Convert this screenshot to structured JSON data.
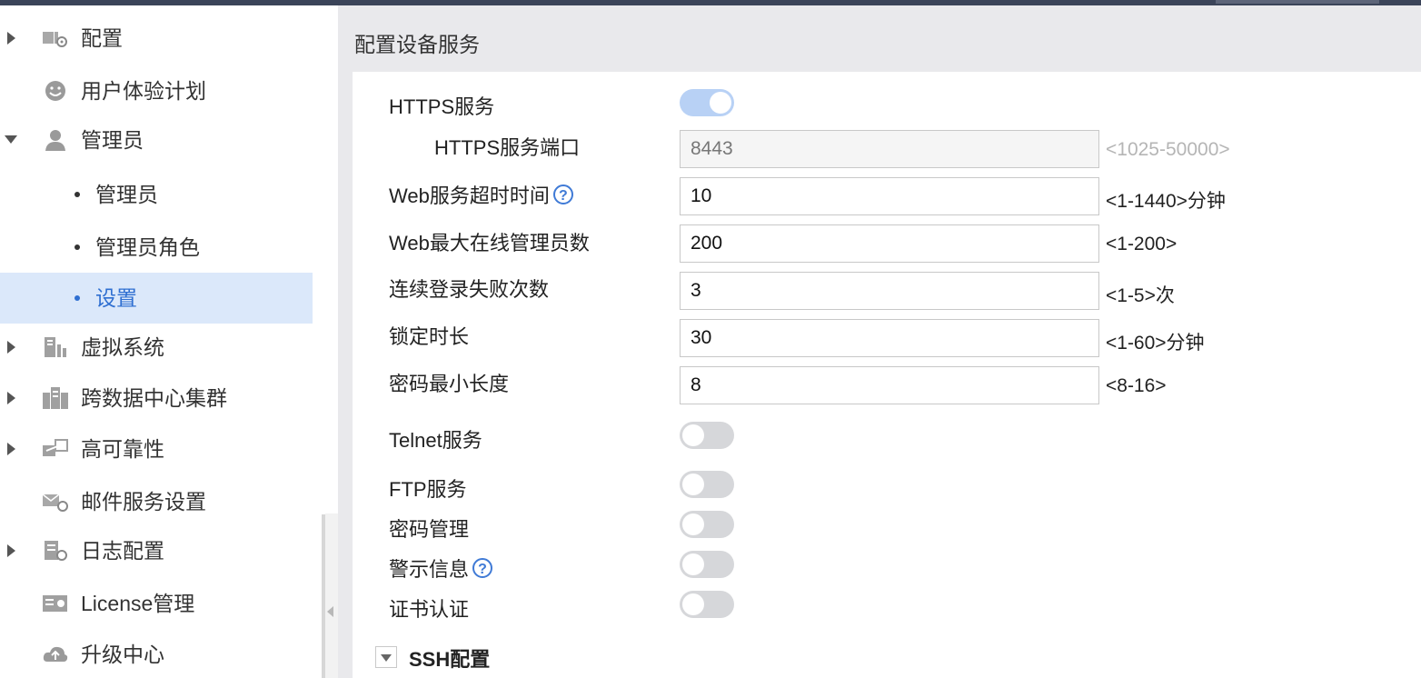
{
  "sidebar": {
    "items": [
      {
        "label": "配置",
        "icon": "config-icon"
      },
      {
        "label": "用户体验计划",
        "icon": "smile-icon"
      },
      {
        "label": "管理员",
        "icon": "admin-icon"
      },
      {
        "label": "管理员"
      },
      {
        "label": "管理员角色"
      },
      {
        "label": "设置"
      },
      {
        "label": "虚拟系统",
        "icon": "virtual-system-icon"
      },
      {
        "label": "跨数据中心集群",
        "icon": "cluster-icon"
      },
      {
        "label": "高可靠性",
        "icon": "ha-icon"
      },
      {
        "label": "邮件服务设置",
        "icon": "mail-settings-icon"
      },
      {
        "label": "日志配置",
        "icon": "log-config-icon"
      },
      {
        "label": "License管理",
        "icon": "license-icon"
      },
      {
        "label": "升级中心",
        "icon": "upgrade-cloud-icon"
      }
    ]
  },
  "main": {
    "title": "配置设备服务",
    "fields": {
      "https_service": {
        "label": "HTTPS服务",
        "enabled": true
      },
      "https_port": {
        "label": "HTTPS服务端口",
        "value": "8443",
        "hint": "<1025-50000>"
      },
      "web_timeout": {
        "label": "Web服务超时时间",
        "value": "10",
        "hint": "<1-1440>分钟"
      },
      "web_max_admins": {
        "label": "Web最大在线管理员数",
        "value": "200",
        "hint": "<1-200>"
      },
      "login_failures": {
        "label": "连续登录失败次数",
        "value": "3",
        "hint": "<1-5>次"
      },
      "lock_duration": {
        "label": "锁定时长",
        "value": "30",
        "hint": "<1-60>分钟"
      },
      "password_min_length": {
        "label": "密码最小长度",
        "value": "8",
        "hint": "<8-16>"
      },
      "telnet_service": {
        "label": "Telnet服务",
        "enabled": false
      },
      "ftp_service": {
        "label": "FTP服务",
        "enabled": false
      },
      "password_management": {
        "label": "密码管理",
        "enabled": false
      },
      "warning_info": {
        "label": "警示信息",
        "enabled": false
      },
      "certificate_auth": {
        "label": "证书认证",
        "enabled": false
      }
    },
    "help_glyph": "?",
    "ssh_section": {
      "label": "SSH配置"
    }
  },
  "colors": {
    "active_bg": "#dbe8fa",
    "active_text": "#2f6fd1",
    "toggle_on": "#b8d1f5",
    "toggle_off": "#d6d7da"
  }
}
